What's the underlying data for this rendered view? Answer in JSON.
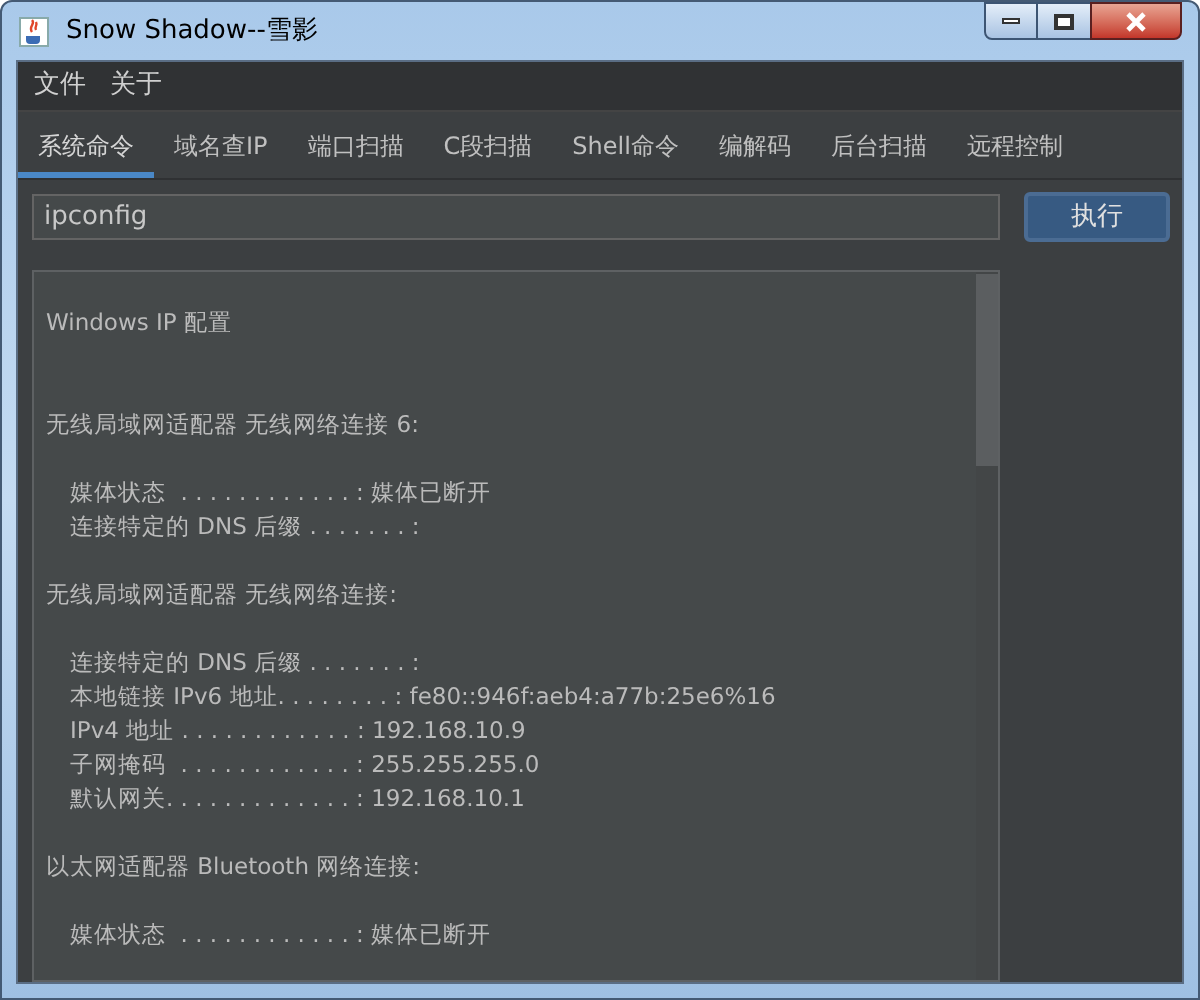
{
  "window": {
    "title": "Snow Shadow--雪影"
  },
  "menu": [
    "文件",
    "关于"
  ],
  "tabs": [
    {
      "label": "系统命令",
      "selected": true
    },
    {
      "label": "域名查IP",
      "selected": false
    },
    {
      "label": "端口扫描",
      "selected": false
    },
    {
      "label": "C段扫描",
      "selected": false
    },
    {
      "label": "Shell命令",
      "selected": false
    },
    {
      "label": "编解码",
      "selected": false
    },
    {
      "label": "后台扫描",
      "selected": false
    },
    {
      "label": "远程控制",
      "selected": false
    }
  ],
  "command": {
    "value": "ipconfig"
  },
  "run_button": "执行",
  "output": {
    "title": "Windows IP 配置",
    "sections": [
      {
        "heading": "无线局域网适配器 无线网络连接 6:",
        "lines": [
          "媒体状态  . . . . . . . . . . . . : 媒体已断开",
          "连接特定的 DNS 后缀 . . . . . . . :"
        ]
      },
      {
        "heading": "无线局域网适配器 无线网络连接:",
        "lines": [
          "连接特定的 DNS 后缀 . . . . . . . :",
          "本地链接 IPv6 地址. . . . . . . . : fe80::946f:aeb4:a77b:25e6%16",
          "IPv4 地址 . . . . . . . . . . . . : 192.168.10.9",
          "子网掩码  . . . . . . . . . . . . : 255.255.255.0",
          "默认网关. . . . . . . . . . . . . : 192.168.10.1"
        ]
      },
      {
        "heading": "以太网适配器 Bluetooth 网络连接:",
        "lines": [
          "媒体状态  . . . . . . . . . . . . : 媒体已断开"
        ]
      }
    ]
  }
}
